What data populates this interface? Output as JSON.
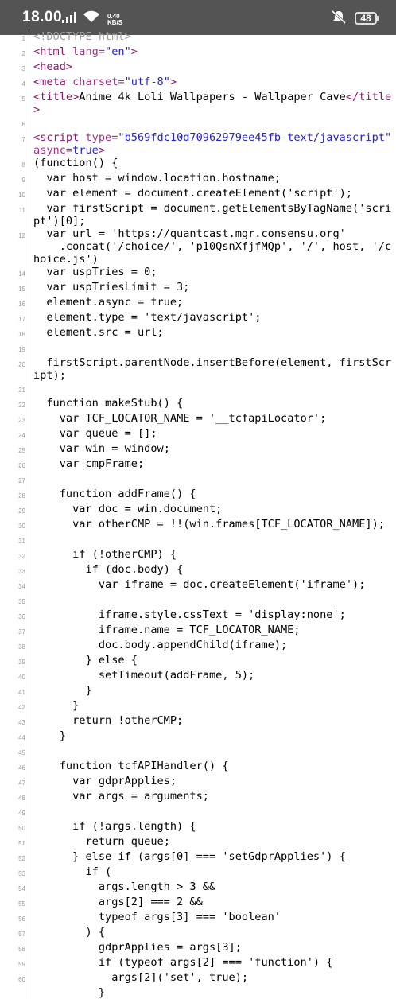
{
  "status_bar": {
    "time": "18.00",
    "network_speed_value": "0.40",
    "network_speed_unit": "KB/S",
    "battery": "48",
    "icons": [
      "signal-icon",
      "wifi-icon",
      "mute-icon",
      "battery-icon"
    ]
  },
  "source_view": {
    "lines": [
      {
        "n": "1",
        "segments": [
          {
            "t": "<!DOCTYPE html>",
            "c": "comment"
          }
        ]
      },
      {
        "n": "2",
        "segments": [
          {
            "t": "<html ",
            "c": "tag"
          },
          {
            "t": "lang=",
            "c": "attr"
          },
          {
            "t": "\"en\"",
            "c": "val"
          },
          {
            "t": ">",
            "c": "tag"
          }
        ]
      },
      {
        "n": "3",
        "segments": [
          {
            "t": "<head>",
            "c": "tag"
          }
        ]
      },
      {
        "n": "4",
        "segments": [
          {
            "t": "<meta ",
            "c": "tag"
          },
          {
            "t": "charset=",
            "c": "attr"
          },
          {
            "t": "\"utf-8\"",
            "c": "val"
          },
          {
            "t": ">",
            "c": "tag"
          }
        ]
      },
      {
        "n": "5",
        "segments": [
          {
            "t": "<title>",
            "c": "tag"
          },
          {
            "t": "Anime 4k Loli Wallpapers - Wallpaper Cave",
            "c": "plain"
          },
          {
            "t": "</title>",
            "c": "tag"
          }
        ]
      },
      {
        "n": "6",
        "segments": [
          {
            "t": "",
            "c": "plain"
          }
        ]
      },
      {
        "n": "7",
        "segments": [
          {
            "t": "<script ",
            "c": "tag"
          },
          {
            "t": "type=",
            "c": "attr"
          },
          {
            "t": "\"b569fdc10d70962979ee45fb-text/javascript\" ",
            "c": "val"
          },
          {
            "t": "async=",
            "c": "attr"
          },
          {
            "t": "true",
            "c": "val"
          },
          {
            "t": ">",
            "c": "tag"
          }
        ]
      },
      {
        "n": "8",
        "segments": [
          {
            "t": "(function() {",
            "c": "plain"
          }
        ]
      },
      {
        "n": "9",
        "segments": [
          {
            "t": "  var host = window.location.hostname;",
            "c": "plain"
          }
        ]
      },
      {
        "n": "10",
        "segments": [
          {
            "t": "  var element = document.createElement('script');",
            "c": "plain"
          }
        ]
      },
      {
        "n": "11",
        "segments": [
          {
            "t": "  var firstScript = document.getElementsByTagName('script')[0];",
            "c": "plain"
          }
        ]
      },
      {
        "n": "12",
        "segments": [
          {
            "t": "  var url = 'https://quantcast.mgr.consensu.org'\n    .concat('/choice/', 'p10QsnXfjfMQp', '/', host, '/choice.js')",
            "c": "plain"
          }
        ]
      },
      {
        "n": "14",
        "segments": [
          {
            "t": "  var uspTries = 0;",
            "c": "plain"
          }
        ]
      },
      {
        "n": "15",
        "segments": [
          {
            "t": "  var uspTriesLimit = 3;",
            "c": "plain"
          }
        ]
      },
      {
        "n": "16",
        "segments": [
          {
            "t": "  element.async = true;",
            "c": "plain"
          }
        ]
      },
      {
        "n": "17",
        "segments": [
          {
            "t": "  element.type = 'text/javascript';",
            "c": "plain"
          }
        ]
      },
      {
        "n": "18",
        "segments": [
          {
            "t": "  element.src = url;",
            "c": "plain"
          }
        ]
      },
      {
        "n": "19",
        "segments": [
          {
            "t": "",
            "c": "plain"
          }
        ]
      },
      {
        "n": "20",
        "segments": [
          {
            "t": "  firstScript.parentNode.insertBefore(element, firstScript);",
            "c": "plain"
          }
        ]
      },
      {
        "n": "21",
        "segments": [
          {
            "t": "",
            "c": "plain"
          }
        ]
      },
      {
        "n": "22",
        "segments": [
          {
            "t": "  function makeStub() {",
            "c": "plain"
          }
        ]
      },
      {
        "n": "23",
        "segments": [
          {
            "t": "    var TCF_LOCATOR_NAME = '__tcfapiLocator';",
            "c": "plain"
          }
        ]
      },
      {
        "n": "24",
        "segments": [
          {
            "t": "    var queue = [];",
            "c": "plain"
          }
        ]
      },
      {
        "n": "25",
        "segments": [
          {
            "t": "    var win = window;",
            "c": "plain"
          }
        ]
      },
      {
        "n": "26",
        "segments": [
          {
            "t": "    var cmpFrame;",
            "c": "plain"
          }
        ]
      },
      {
        "n": "27",
        "segments": [
          {
            "t": "",
            "c": "plain"
          }
        ]
      },
      {
        "n": "28",
        "segments": [
          {
            "t": "    function addFrame() {",
            "c": "plain"
          }
        ]
      },
      {
        "n": "29",
        "segments": [
          {
            "t": "      var doc = win.document;",
            "c": "plain"
          }
        ]
      },
      {
        "n": "30",
        "segments": [
          {
            "t": "      var otherCMP = !!(win.frames[TCF_LOCATOR_NAME]);",
            "c": "plain"
          }
        ]
      },
      {
        "n": "31",
        "segments": [
          {
            "t": "",
            "c": "plain"
          }
        ]
      },
      {
        "n": "32",
        "segments": [
          {
            "t": "      if (!otherCMP) {",
            "c": "plain"
          }
        ]
      },
      {
        "n": "33",
        "segments": [
          {
            "t": "        if (doc.body) {",
            "c": "plain"
          }
        ]
      },
      {
        "n": "34",
        "segments": [
          {
            "t": "          var iframe = doc.createElement('iframe');",
            "c": "plain"
          }
        ]
      },
      {
        "n": "35",
        "segments": [
          {
            "t": "",
            "c": "plain"
          }
        ]
      },
      {
        "n": "36",
        "segments": [
          {
            "t": "          iframe.style.cssText = 'display:none';",
            "c": "plain"
          }
        ]
      },
      {
        "n": "37",
        "segments": [
          {
            "t": "          iframe.name = TCF_LOCATOR_NAME;",
            "c": "plain"
          }
        ]
      },
      {
        "n": "38",
        "segments": [
          {
            "t": "          doc.body.appendChild(iframe);",
            "c": "plain"
          }
        ]
      },
      {
        "n": "39",
        "segments": [
          {
            "t": "        } else {",
            "c": "plain"
          }
        ]
      },
      {
        "n": "40",
        "segments": [
          {
            "t": "          setTimeout(addFrame, 5);",
            "c": "plain"
          }
        ]
      },
      {
        "n": "41",
        "segments": [
          {
            "t": "        }",
            "c": "plain"
          }
        ]
      },
      {
        "n": "42",
        "segments": [
          {
            "t": "      }",
            "c": "plain"
          }
        ]
      },
      {
        "n": "43",
        "segments": [
          {
            "t": "      return !otherCMP;",
            "c": "plain"
          }
        ]
      },
      {
        "n": "44",
        "segments": [
          {
            "t": "    }",
            "c": "plain"
          }
        ]
      },
      {
        "n": "45",
        "segments": [
          {
            "t": "",
            "c": "plain"
          }
        ]
      },
      {
        "n": "46",
        "segments": [
          {
            "t": "    function tcfAPIHandler() {",
            "c": "plain"
          }
        ]
      },
      {
        "n": "47",
        "segments": [
          {
            "t": "      var gdprApplies;",
            "c": "plain"
          }
        ]
      },
      {
        "n": "48",
        "segments": [
          {
            "t": "      var args = arguments;",
            "c": "plain"
          }
        ]
      },
      {
        "n": "49",
        "segments": [
          {
            "t": "",
            "c": "plain"
          }
        ]
      },
      {
        "n": "50",
        "segments": [
          {
            "t": "      if (!args.length) {",
            "c": "plain"
          }
        ]
      },
      {
        "n": "51",
        "segments": [
          {
            "t": "        return queue;",
            "c": "plain"
          }
        ]
      },
      {
        "n": "52",
        "segments": [
          {
            "t": "      } else if (args[0] === 'setGdprApplies') {",
            "c": "plain"
          }
        ]
      },
      {
        "n": "53",
        "segments": [
          {
            "t": "        if (",
            "c": "plain"
          }
        ]
      },
      {
        "n": "54",
        "segments": [
          {
            "t": "          args.length > 3 &&",
            "c": "plain"
          }
        ]
      },
      {
        "n": "55",
        "segments": [
          {
            "t": "          args[2] === 2 &&",
            "c": "plain"
          }
        ]
      },
      {
        "n": "56",
        "segments": [
          {
            "t": "          typeof args[3] === 'boolean'",
            "c": "plain"
          }
        ]
      },
      {
        "n": "57",
        "segments": [
          {
            "t": "        ) {",
            "c": "plain"
          }
        ]
      },
      {
        "n": "58",
        "segments": [
          {
            "t": "          gdprApplies = args[3];",
            "c": "plain"
          }
        ]
      },
      {
        "n": "59",
        "segments": [
          {
            "t": "          if (typeof args[2] === 'function') {",
            "c": "plain"
          }
        ]
      },
      {
        "n": "60",
        "segments": [
          {
            "t": "            args[2]('set', true);",
            "c": "plain"
          }
        ]
      },
      {
        "n": "",
        "segments": [
          {
            "t": "          }",
            "c": "plain"
          }
        ]
      }
    ]
  }
}
